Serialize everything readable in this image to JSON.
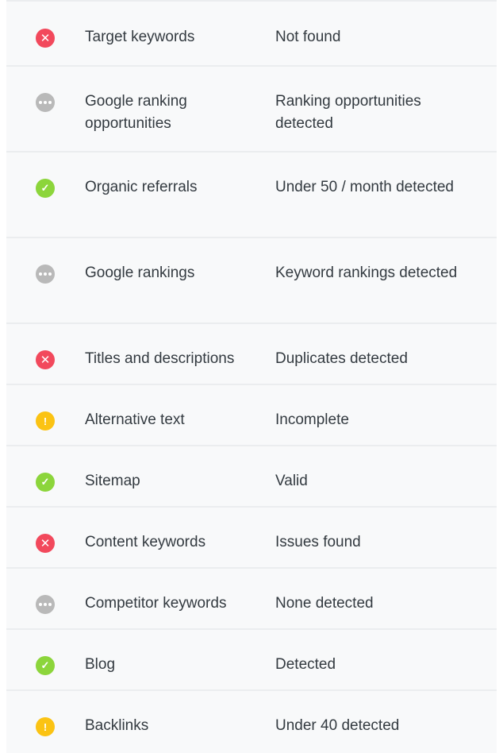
{
  "checks": [
    {
      "name": "Target keywords",
      "result": "Not found",
      "status": "fail",
      "icon": "x-icon"
    },
    {
      "name": "Google ranking opportunities",
      "result": "Ranking opportunities detected",
      "status": "info",
      "icon": "ellipsis-icon"
    },
    {
      "name": "Organic referrals",
      "result": "Under 50 / month detected",
      "status": "pass",
      "icon": "check-icon"
    },
    {
      "name": "Google rankings",
      "result": "Keyword rankings detected",
      "status": "info",
      "icon": "ellipsis-icon"
    },
    {
      "name": "Titles and descriptions",
      "result": "Duplicates detected",
      "status": "fail",
      "icon": "x-icon"
    },
    {
      "name": "Alternative text",
      "result": "Incomplete",
      "status": "warn",
      "icon": "exclamation-icon"
    },
    {
      "name": "Sitemap",
      "result": "Valid",
      "status": "pass",
      "icon": "check-icon"
    },
    {
      "name": "Content keywords",
      "result": "Issues found",
      "status": "fail",
      "icon": "x-icon"
    },
    {
      "name": "Competitor keywords",
      "result": "None detected",
      "status": "info",
      "icon": "ellipsis-icon"
    },
    {
      "name": "Blog",
      "result": "Detected",
      "status": "pass",
      "icon": "check-icon"
    },
    {
      "name": "Backlinks",
      "result": "Under 40 detected",
      "status": "warn",
      "icon": "exclamation-icon"
    }
  ],
  "colors": {
    "fail": "#f2495c",
    "pass": "#8cd53b",
    "info": "#b9b9b9",
    "warn": "#fbc313"
  }
}
